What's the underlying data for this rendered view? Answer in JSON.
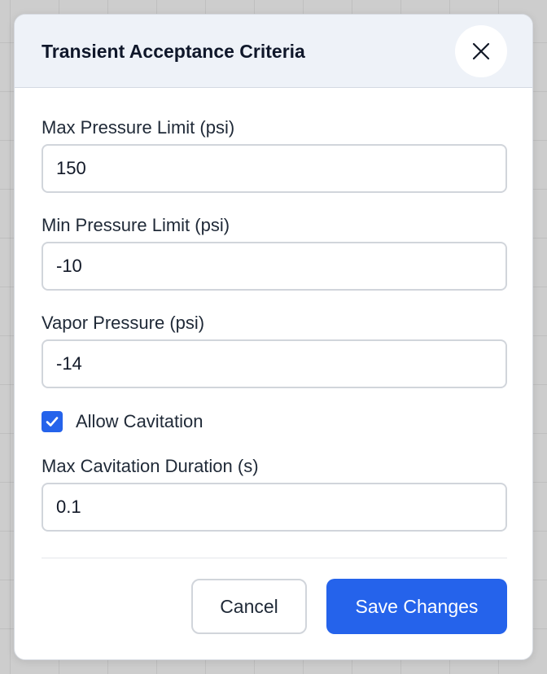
{
  "dialog": {
    "title": "Transient Acceptance Criteria",
    "close_icon": "close-icon"
  },
  "fields": {
    "max_pressure": {
      "label": "Max Pressure Limit (psi)",
      "value": "150"
    },
    "min_pressure": {
      "label": "Min Pressure Limit (psi)",
      "value": "-10"
    },
    "vapor_pressure": {
      "label": "Vapor Pressure (psi)",
      "value": "-14"
    },
    "allow_cavitation": {
      "label": "Allow Cavitation",
      "checked": true,
      "check_icon": "checkmark-icon"
    },
    "max_cavitation_duration": {
      "label": "Max Cavitation Duration (s)",
      "value": "0.1"
    }
  },
  "actions": {
    "cancel_label": "Cancel",
    "save_label": "Save Changes"
  },
  "colors": {
    "accent": "#2563eb",
    "header_bg": "#eef2f8",
    "title_text": "#0f172a",
    "backdrop": "#cdcdcd"
  }
}
